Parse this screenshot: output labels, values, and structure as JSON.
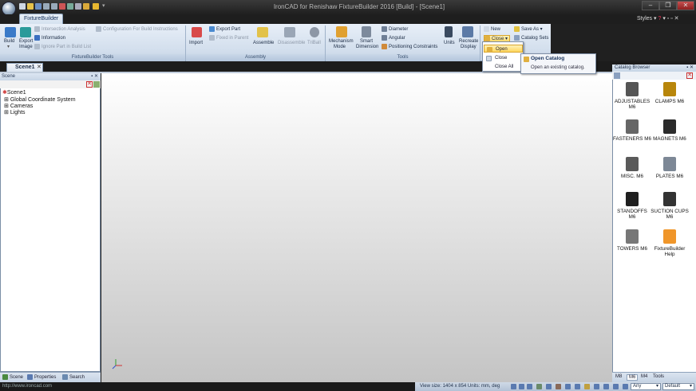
{
  "window": {
    "title": "IronCAD for Renishaw FixtureBuilder 2016 [Build] - [Scene1]",
    "controls": {
      "minimize": "–",
      "restore": "❐",
      "close": "✕"
    }
  },
  "ribbon": {
    "active_tab": "FixtureBuilder",
    "styles_label": "Styles",
    "groups": {
      "fixturebuilder_tools": {
        "label": "FixtureBuilder Tools",
        "build": "Build",
        "export": "Export",
        "image": "Image",
        "intersection_analysis": "Intersection Analysis",
        "information": "Information",
        "ignore_part": "Ignore Part in Build List",
        "configuration": "Configuration For Build Instructions"
      },
      "assembly": {
        "label": "Assembly",
        "import": "Import",
        "export_part": "Export Part",
        "fixed_in_parent": "Fixed in Parent",
        "assemble": "Assemble",
        "disassemble": "Disassemble",
        "triball": "TriBall"
      },
      "tools": {
        "label": "Tools",
        "mechanism": "Mechanism",
        "mode": "Mode",
        "smart": "Smart",
        "dimension": "Dimension",
        "diameter": "Diameter",
        "angular": "Angular",
        "positioning": "Positioning Constraints",
        "units": "Units",
        "recreate": "Recreate",
        "display": "Display"
      },
      "catalog": {
        "new": "New",
        "close": "Close",
        "save_as": "Save As",
        "catalog_sets": "Catalog Sets"
      }
    }
  },
  "dropdown": {
    "open": "Open",
    "close": "Close",
    "close_all": "Close All"
  },
  "submenu": {
    "title": "Open Catalog",
    "description": "Open an existing catalog."
  },
  "document_tab": {
    "label": "Scene1",
    "close": "✕"
  },
  "scene_panel": {
    "header": "Scene",
    "tree": [
      "Scene1",
      "Global Coordinate System",
      "Cameras",
      "Lights"
    ],
    "tabs": {
      "scene": "Scene",
      "properties": "Properties",
      "search": "Search"
    }
  },
  "catalog_browser": {
    "header": "Catalog Browser",
    "items": [
      {
        "label": "ADJUSTABLES M6",
        "color": "#555555"
      },
      {
        "label": "CLAMPS  M6",
        "color": "#b8860b"
      },
      {
        "label": "FASTENERS M6",
        "color": "#666666"
      },
      {
        "label": "MAGNETS  M6",
        "color": "#2b2b2b"
      },
      {
        "label": "MISC.  M6",
        "color": "#5a5a5a"
      },
      {
        "label": "PLATES  M6",
        "color": "#7d8896"
      },
      {
        "label": "STANDOFFS M6",
        "color": "#1f1f1f"
      },
      {
        "label": "SUCTION CUPS  M6",
        "color": "#333333"
      },
      {
        "label": "TOWERS  M6",
        "color": "#777777"
      },
      {
        "label": "FixtureBuilder Help",
        "color": "#f0962a"
      }
    ],
    "tabs": [
      "M8",
      "M6",
      "M4",
      "Tools"
    ]
  },
  "status": {
    "url": "http://www.ironcad.com",
    "view_size": "View size: 1404 x 854    Units: mm, deg",
    "filter": "Any",
    "style": "Default"
  }
}
